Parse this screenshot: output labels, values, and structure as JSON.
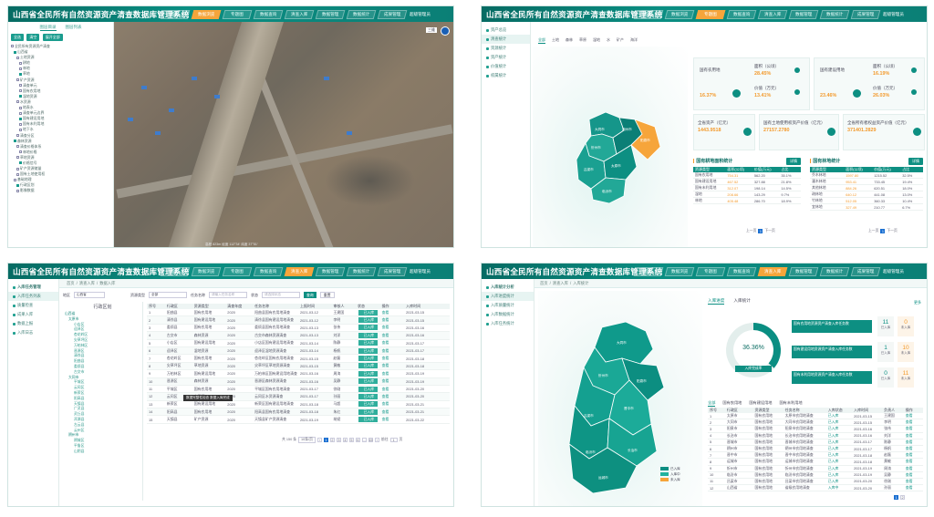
{
  "app": {
    "title": "山西省全民所有自然资源资产清查数据库管理系统",
    "nav": [
      "首页",
      "数据浏览",
      "专题图",
      "数据查询",
      "清查入库",
      "数据管理",
      "数据统计",
      "成果管理",
      "系统管理"
    ],
    "user": "超级管理员"
  },
  "panel1": {
    "tabs": [
      "图层目录",
      "图层列表"
    ],
    "buttons": [
      "全选",
      "清空",
      "展开全部"
    ],
    "tree": [
      "全民所有资源资产清查",
      "山西省",
      "土地资源",
      "耕地",
      "林地",
      "草地",
      "矿产资源",
      "清查单元",
      "国有农用地",
      "湿地资源",
      "水资源",
      "地表水",
      "清查单元边界",
      "国有建设用地",
      "国有未利用地",
      "地下水",
      "清查分区",
      "森林资源",
      "清查价格体系",
      "林地价格",
      "草地资源",
      "价格信号",
      "矿产资源储量",
      "国有土地使用权",
      "基础地理",
      "行政区划",
      "影像数据"
    ],
    "scene": {
      "minimap": "三维",
      "footer": "高程 823m  经度 112°34′  纬度 37°51′"
    }
  },
  "panel2": {
    "side": [
      "资产总览",
      "清查统计",
      "资源统计",
      "资产统计",
      "价值统计",
      "权属统计"
    ],
    "filter_tabs": [
      "全部",
      "土地",
      "森林",
      "草原",
      "湿地",
      "水",
      "矿产",
      "海洋"
    ],
    "cards": [
      {
        "label": "国有农用地",
        "value": "16.37%",
        "sub1": "面积（公顷）",
        "v1": "28.45%",
        "sub2": "价值（万元）",
        "v2": "13.41%"
      },
      {
        "label": "国有建设用地",
        "value": "23.46%",
        "sub1": "面积（公顷）",
        "v1": "16.19%",
        "sub2": "价值（万元）",
        "v2": "26.03%"
      }
    ],
    "totals": [
      {
        "label": "全省资产（亿元）",
        "value": "1443.9518"
      },
      {
        "label": "国有土地使用权资产价值（亿元）",
        "value": "27157.2780"
      },
      {
        "label": "全省所有者权益资产价值（亿元）",
        "value": "371401.2829"
      }
    ],
    "map_labels": [
      "大同市",
      "朔州市",
      "忻州市",
      "太原市",
      "吕梁市",
      "晋中市",
      "阳泉市",
      "长治市",
      "临汾市",
      "晋城市",
      "运城市"
    ],
    "tables": [
      {
        "title": "国有耕地面积统计",
        "button": "详情",
        "head": [
          "资源类型",
          "面积(公顷)",
          "价值(万元)",
          "占比"
        ],
        "rows": [
          [
            "国有农用地",
            "754.31",
            "562.20",
            "35.1%"
          ],
          [
            "国有建设用地",
            "467.52",
            "327.88",
            "21.8%"
          ],
          [
            "国有未利用地",
            "312.07",
            "198.14",
            "14.5%"
          ],
          [
            "湿地",
            "208.66",
            "143.29",
            "9.7%"
          ],
          [
            "林地",
            "405.48",
            "286.70",
            "18.9%"
          ]
        ],
        "pages": [
          "上一页",
          "1",
          "下一页"
        ]
      },
      {
        "title": "国有林地统计",
        "button": "详情",
        "head": [
          "资源类型",
          "面积(公顷)",
          "价值(万元)",
          "占比"
        ],
        "rows": [
          [
            "乔木林地",
            "1597.80",
            "1215.52",
            "32.5%"
          ],
          [
            "灌木林地",
            "953.41",
            "733.45",
            "19.4%"
          ],
          [
            "其他林地",
            "884.26",
            "620.51",
            "18.0%"
          ],
          [
            "疏林地",
            "640.12",
            "441.08",
            "13.0%"
          ],
          [
            "竹林地",
            "512.05",
            "360.33",
            "10.4%"
          ],
          [
            "宜林地",
            "327.49",
            "210.77",
            "6.7%"
          ]
        ],
        "pages": [
          "上一页",
          "1",
          "下一页"
        ]
      }
    ]
  },
  "panel3": {
    "breadcrumb": [
      "首页",
      "清查入库",
      "数据入库"
    ],
    "side": [
      "入库任务管理",
      "入库任务列表",
      "质量检查",
      "成果入库",
      "数据上报",
      "入库日志"
    ],
    "filters": {
      "region_label": "地区",
      "region_value": "山西省",
      "type_label": "资源类型",
      "type_value": "全部",
      "name_label": "任务名称",
      "name_ph": "请输入任务名称",
      "status_label": "状态",
      "status_ph": "请选择状态",
      "search": "查询",
      "reset": "重置"
    },
    "tree_title": "行政区划",
    "tree": [
      "山西省",
      "太原市",
      "小店区",
      "迎泽区",
      "杏花岭区",
      "尖草坪区",
      "万柏林区",
      "晋源区",
      "清徐县",
      "阳曲县",
      "娄烦县",
      "古交市",
      "大同市",
      "平城区",
      "云冈区",
      "新荣区",
      "阳高县",
      "天镇县",
      "广灵县",
      "灵丘县",
      "浑源县",
      "左云县",
      "云州区",
      "朔州市",
      "朔城区",
      "平鲁区",
      "山阴县"
    ],
    "tooltip": "数据完整性检查 数据入库完成",
    "head": [
      "序号",
      "行政区",
      "资源类型",
      "清查年度",
      "任务名称",
      "上报时间",
      "审核人",
      "状态",
      "操作",
      "入库时间"
    ],
    "rows": [
      [
        "1",
        "阳曲县",
        "国有农用地",
        "2020",
        "阳曲县国有农用地清查",
        "2021-03-12",
        "王建国",
        "已入库",
        "查看",
        "2021-03-15"
      ],
      [
        "2",
        "清徐县",
        "国有建设用地",
        "2020",
        "清徐县国有建设用地清查",
        "2021-03-12",
        "李明",
        "已入库",
        "查看",
        "2021-03-15"
      ],
      [
        "3",
        "娄烦县",
        "国有农用地",
        "2020",
        "娄烦县国有农用地清查",
        "2021-03-13",
        "张伟",
        "已入库",
        "查看",
        "2021-03-16"
      ],
      [
        "4",
        "古交市",
        "森林资源",
        "2020",
        "古交市森林资源清查",
        "2021-03-13",
        "刘洋",
        "已入库",
        "查看",
        "2021-03-16"
      ],
      [
        "5",
        "小店区",
        "国有建设用地",
        "2020",
        "小店区国有建设用地清查",
        "2021-03-14",
        "陈静",
        "已入库",
        "查看",
        "2021-03-17"
      ],
      [
        "6",
        "迎泽区",
        "湿地资源",
        "2020",
        "迎泽区湿地资源清查",
        "2021-03-14",
        "杨帆",
        "已入库",
        "查看",
        "2021-03-17"
      ],
      [
        "7",
        "杏花岭区",
        "国有农用地",
        "2020",
        "杏花岭区国有农用地清查",
        "2021-03-15",
        "赵磊",
        "已入库",
        "查看",
        "2021-03-18"
      ],
      [
        "8",
        "尖草坪区",
        "草地资源",
        "2020",
        "尖草坪区草地资源清查",
        "2021-03-15",
        "黄敏",
        "已入库",
        "查看",
        "2021-03-18"
      ],
      [
        "9",
        "万柏林区",
        "国有建设用地",
        "2020",
        "万柏林区国有建设用地清查",
        "2021-03-16",
        "周涛",
        "已入库",
        "查看",
        "2021-03-19"
      ],
      [
        "10",
        "晋源区",
        "森林资源",
        "2020",
        "晋源区森林资源清查",
        "2021-03-16",
        "吴静",
        "已入库",
        "查看",
        "2021-03-19"
      ],
      [
        "11",
        "平城区",
        "国有农用地",
        "2020",
        "平城区国有农用地清查",
        "2021-03-17",
        "徐刚",
        "已入库",
        "查看",
        "2021-03-20"
      ],
      [
        "12",
        "云冈区",
        "水资源",
        "2020",
        "云冈区水资源清查",
        "2021-03-17",
        "孙丽",
        "已入库",
        "查看",
        "2021-03-20"
      ],
      [
        "13",
        "新荣区",
        "国有建设用地",
        "2020",
        "新荣区国有建设用地清查",
        "2021-03-18",
        "马超",
        "已入库",
        "查看",
        "2021-03-21"
      ],
      [
        "14",
        "阳高县",
        "国有农用地",
        "2020",
        "阳高县国有农用地清查",
        "2021-03-18",
        "朱红",
        "已入库",
        "查看",
        "2021-03-21"
      ],
      [
        "15",
        "天镇县",
        "矿产资源",
        "2020",
        "天镇县矿产资源清查",
        "2021-03-19",
        "胡斌",
        "已入库",
        "查看",
        "2021-03-22"
      ]
    ],
    "pager": {
      "total": "共 150 条",
      "size": "10条/页",
      "pages": [
        "1",
        "2",
        "3",
        "4",
        "5",
        "6",
        "...",
        "15"
      ],
      "goto": "前往",
      "page": "1",
      "unit": "页"
    }
  },
  "panel4": {
    "breadcrumb": [
      "首页",
      "清查入库",
      "入库统计"
    ],
    "side": [
      "入库统计分析",
      "入库进度统计",
      "入库质量统计",
      "入库数据统计",
      "入库任务统计"
    ],
    "tabs": [
      "入库进度",
      "入库统计"
    ],
    "more": "更多",
    "gauge": {
      "value": "36.36%",
      "label": "入库完成率"
    },
    "stats": [
      {
        "label": "国有农用地资源资产清查入库任务数",
        "a": "11",
        "al": "已入库",
        "b": "0",
        "bl": "未入库"
      },
      {
        "label": "国有建设用地资源资产清查入库任务数",
        "a": "1",
        "al": "已入库",
        "b": "10",
        "bl": "未入库"
      },
      {
        "label": "国有未利用地资源资产清查入库任务数",
        "a": "0",
        "al": "已入库",
        "b": "11",
        "bl": "未入库"
      }
    ],
    "legend": [
      "已入库",
      "入库中",
      "未入库"
    ],
    "tabs2": [
      "全部",
      "国有农用地",
      "国有建设用地",
      "国有未利用地"
    ],
    "head": [
      "序号",
      "行政区",
      "资源类型",
      "任务名称",
      "入库状态",
      "入库时间",
      "负责人",
      "操作"
    ],
    "rows": [
      [
        "1",
        "太原市",
        "国有农用地",
        "太原市农用地清查",
        "已入库",
        "2021-03-15",
        "王建国",
        "查看"
      ],
      [
        "2",
        "大同市",
        "国有农用地",
        "大同市农用地清查",
        "已入库",
        "2021-03-15",
        "李明",
        "查看"
      ],
      [
        "3",
        "阳泉市",
        "国有农用地",
        "阳泉市农用地清查",
        "已入库",
        "2021-03-16",
        "张伟",
        "查看"
      ],
      [
        "4",
        "长治市",
        "国有农用地",
        "长治市农用地清查",
        "已入库",
        "2021-03-16",
        "刘洋",
        "查看"
      ],
      [
        "5",
        "晋城市",
        "国有农用地",
        "晋城市农用地清查",
        "已入库",
        "2021-03-17",
        "陈静",
        "查看"
      ],
      [
        "6",
        "朔州市",
        "国有农用地",
        "朔州市农用地清查",
        "已入库",
        "2021-03-17",
        "杨帆",
        "查看"
      ],
      [
        "7",
        "晋中市",
        "国有农用地",
        "晋中市农用地清查",
        "已入库",
        "2021-03-18",
        "赵磊",
        "查看"
      ],
      [
        "8",
        "运城市",
        "国有农用地",
        "运城市农用地清查",
        "已入库",
        "2021-03-18",
        "黄敏",
        "查看"
      ],
      [
        "9",
        "忻州市",
        "国有农用地",
        "忻州市农用地清查",
        "已入库",
        "2021-03-19",
        "周涛",
        "查看"
      ],
      [
        "10",
        "临汾市",
        "国有农用地",
        "临汾市农用地清查",
        "已入库",
        "2021-03-19",
        "吴静",
        "查看"
      ],
      [
        "11",
        "吕梁市",
        "国有农用地",
        "吕梁市农用地清查",
        "已入库",
        "2021-03-20",
        "徐刚",
        "查看"
      ],
      [
        "12",
        "山西省",
        "国有农用地",
        "省级农用地清查",
        "入库中",
        "2021-03-20",
        "孙丽",
        "查看"
      ]
    ],
    "pager": {
      "pages": [
        "1",
        "2"
      ]
    }
  },
  "colors": {
    "primary": "#0b8f82",
    "accent": "#f39a2d",
    "highlight": "#1a6fd1"
  }
}
